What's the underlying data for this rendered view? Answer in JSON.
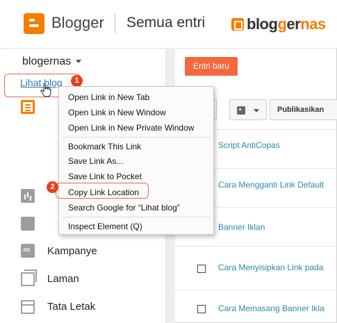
{
  "header": {
    "brand": "Blogger",
    "page_title": "Semua entri",
    "watermark": {
      "part1": "blog",
      "part2": "er",
      "part3": "nas",
      "part_g": "g"
    }
  },
  "sidebar": {
    "blog_name": "blogernas",
    "view_blog_link": "Lihat blog",
    "items": [
      {
        "icon": "posts-icon",
        "label": ""
      },
      {
        "icon": "stats-icon",
        "label": ""
      },
      {
        "icon": "comments-icon",
        "label": ""
      },
      {
        "icon": "campaign-icon",
        "label": "Kampanye",
        "icon_text": "AD"
      },
      {
        "icon": "pages-icon",
        "label": "Laman"
      },
      {
        "icon": "layout-icon",
        "label": "Tata Letak"
      }
    ]
  },
  "main": {
    "new_post_button": "Entri baru",
    "publish_button": "Publikasikan",
    "posts": [
      {
        "title": "Script AntiCopas"
      },
      {
        "title": "Cara Mengganti Link Default"
      },
      {
        "title": "Banner Iklan"
      },
      {
        "title": "Cara Menyisipkan Link pada"
      },
      {
        "title": "Cara Memasang Banner Ikla"
      }
    ]
  },
  "context_menu": {
    "items": [
      {
        "label": "Open Link in New Tab"
      },
      {
        "label": "Open Link in New Window"
      },
      {
        "label": "Open Link in New Private Window"
      },
      {
        "label": "Bookmark This Link"
      },
      {
        "label": "Save Link As..."
      },
      {
        "label": "Save Link to Pocket"
      },
      {
        "label": "Copy Link Location"
      },
      {
        "label": "Search Google for “Lihat blog”"
      },
      {
        "label": "Inspect Element (Q)"
      }
    ]
  },
  "annotations": {
    "step1": "1",
    "step2": "2"
  },
  "colors": {
    "accent": "#f57d00",
    "button": "#f5683e",
    "link": "#2a8aa8",
    "highlight": "#e8401c"
  }
}
